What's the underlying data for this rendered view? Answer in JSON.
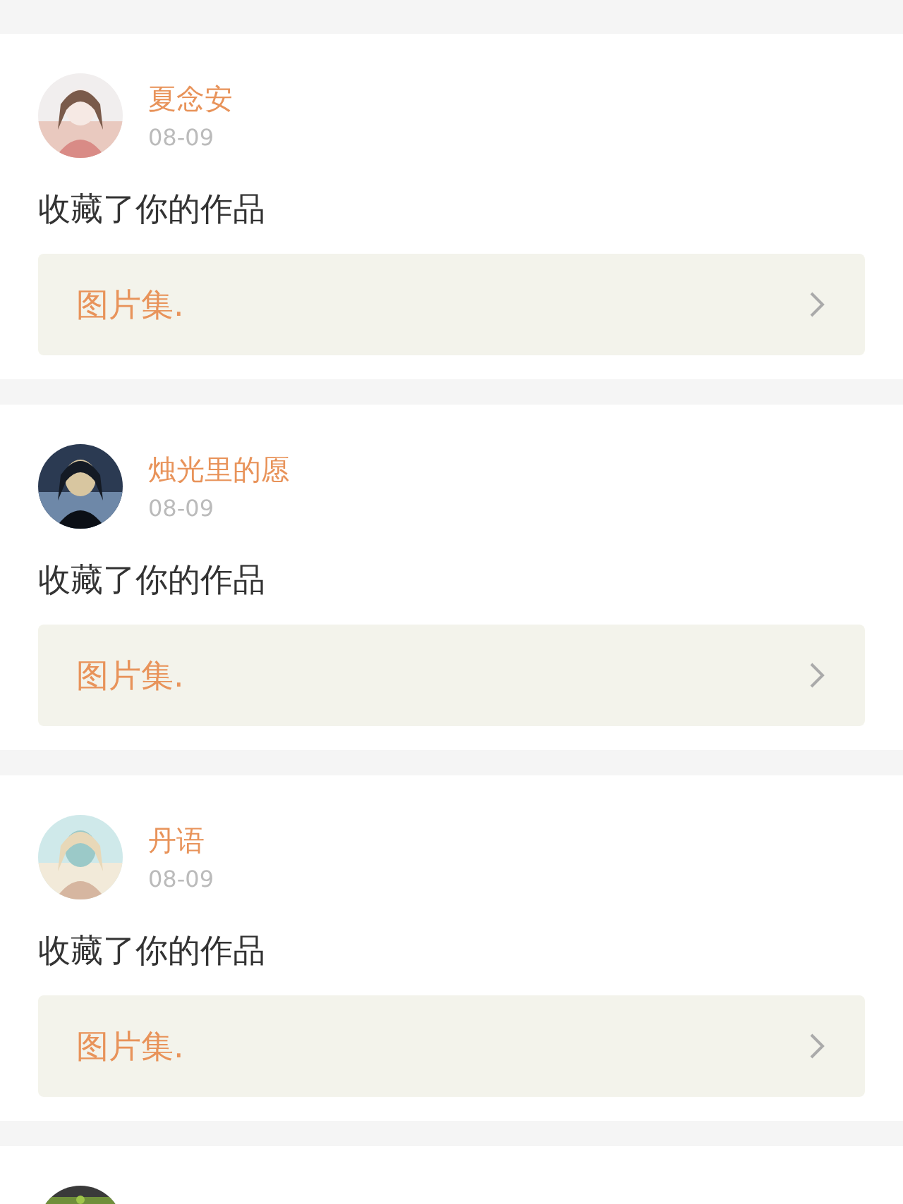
{
  "notifications": [
    {
      "name": "夏念安",
      "date": "08-09",
      "action": "收藏了你的作品",
      "work": "图片集."
    },
    {
      "name": "烛光里的愿",
      "date": "08-09",
      "action": "收藏了你的作品",
      "work": "图片集."
    },
    {
      "name": "丹语",
      "date": "08-09",
      "action": "收藏了你的作品",
      "work": "图片集."
    }
  ]
}
